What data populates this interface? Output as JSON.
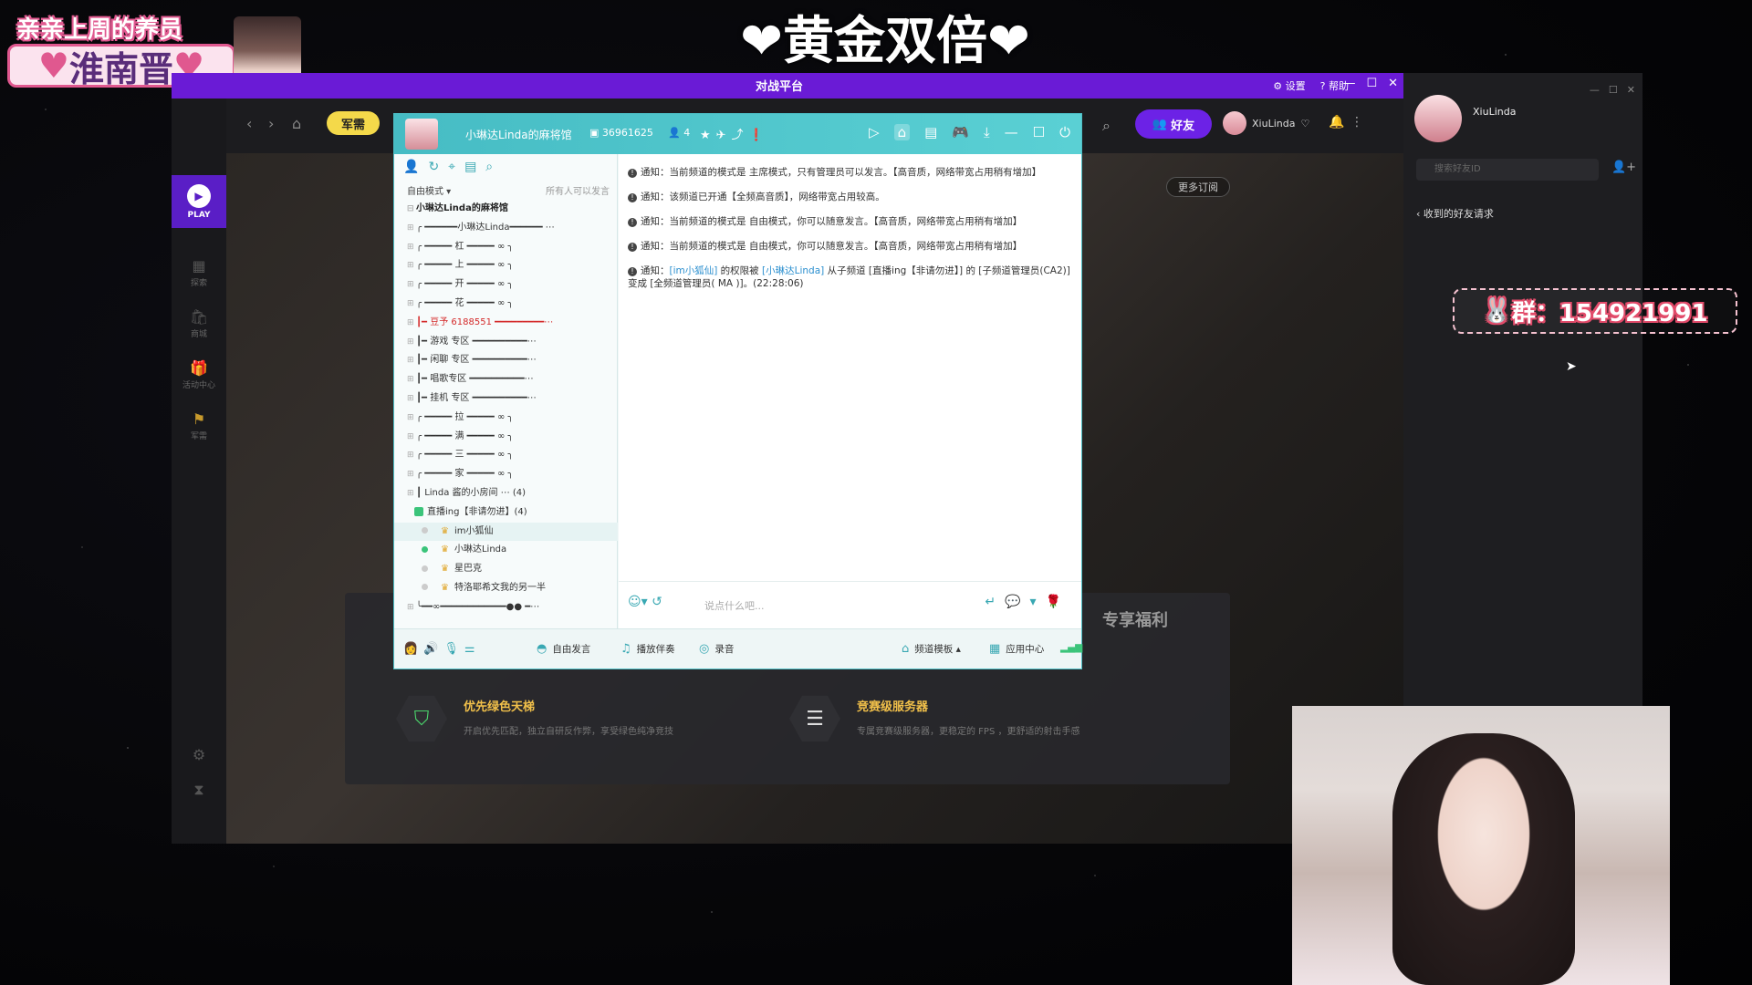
{
  "overlay": {
    "tag_top": "亲亲上周的养员",
    "tag_name": "淮南晋",
    "title": "黄金双倍",
    "group_banner": "群：154921991"
  },
  "app": {
    "logo": "对战平台",
    "settings_label": "设置",
    "help_label": "帮助",
    "junxu_label": "军需",
    "play_label": "PLAY",
    "sidebar": [
      {
        "label": "探索",
        "icon": "explore-icon"
      },
      {
        "label": "商城",
        "icon": "shop-icon"
      },
      {
        "label": "活动中心",
        "icon": "gift-icon"
      },
      {
        "label": "军需",
        "icon": "flag-icon"
      }
    ],
    "friend_button": "好友",
    "username": "XiuLinda",
    "more_subscriptions": "更多订阅",
    "perk_title_right": "专享福利",
    "perks": [
      {
        "title": "优先绿色天梯",
        "desc": "开启优先匹配，独立自研反作弊，享受绿色纯净竞技"
      },
      {
        "title": "竞赛级服务器",
        "desc": "专属竞赛级服务器，更稳定的 FPS ，更舒适的射击手感"
      }
    ]
  },
  "room": {
    "name": "小琳达Linda的麻将馆",
    "id": "36961625",
    "online": "4",
    "mode": "自由模式",
    "mode_right": "所有人可以发言",
    "channels": [
      {
        "text": "小琳达Linda的麻将馆",
        "style": "bold"
      },
      {
        "text": "╭ ━━━━━━小琳达Linda━━━━━━ ⋯",
        "style": ""
      },
      {
        "text": "╭ ━━━━━ 杠 ━━━━━ ∞ ╮",
        "style": ""
      },
      {
        "text": "╭ ━━━━━ 上 ━━━━━ ∞ ╮",
        "style": ""
      },
      {
        "text": "╭ ━━━━━ 开 ━━━━━ ∞ ╮",
        "style": ""
      },
      {
        "text": "╭ ━━━━━ 花 ━━━━━ ∞ ╮",
        "style": ""
      },
      {
        "text": "┃━ 豆予 6188551 ━━━━━━━━━⋯",
        "style": "red"
      },
      {
        "text": "┃━ 游戏 专区 ━━━━━━━━━━⋯",
        "style": ""
      },
      {
        "text": "┃━ 闲聊 专区 ━━━━━━━━━━⋯",
        "style": ""
      },
      {
        "text": "┃━ 唱歌专区 ━━━━━━━━━━⋯",
        "style": ""
      },
      {
        "text": "┃━ 挂机 专区 ━━━━━━━━━━⋯",
        "style": ""
      },
      {
        "text": "╭ ━━━━━ 拉 ━━━━━ ∞ ╮",
        "style": ""
      },
      {
        "text": "╭ ━━━━━ 满 ━━━━━ ∞ ╮",
        "style": ""
      },
      {
        "text": "╭ ━━━━━ 三 ━━━━━ ∞ ╮",
        "style": ""
      },
      {
        "text": "╭ ━━━━━ 家 ━━━━━ ∞ ╮",
        "style": ""
      },
      {
        "text": "┃            Linda 酱的小房间  ⋯ (4)",
        "style": ""
      }
    ],
    "subchannel": "直播ing【非请勿进】(4)",
    "users": [
      {
        "name": "im小狐仙",
        "online": false
      },
      {
        "name": "小琳达Linda",
        "online": true
      },
      {
        "name": "星巴克",
        "online": false
      },
      {
        "name": "特洛耶希文我的另一半",
        "online": false
      }
    ],
    "last_channel": "╰━━∞━━━━━━━━━━━━●● ━⋯",
    "notices": [
      "通知：当前频道的模式是 主席模式，只有管理员可以发言。【高音质，网络带宽占用稍有增加】",
      "通知：该频道已开通【全频高音质】，网络带宽占用较高。",
      "通知：当前频道的模式是 自由模式，你可以随意发言。【高音质，网络带宽占用稍有增加】",
      "通知：当前频道的模式是 自由模式，你可以随意发言。【高音质，网络带宽占用稍有增加】"
    ],
    "notice5": {
      "prefix": "通知：",
      "user1": "[im小狐仙]",
      "mid": " 的权限被 ",
      "user2": "[小琳达Linda]",
      "rest": " 从子频道 [直播ing【非请勿进】] 的 [子频道管理员(CA2)] 变成 [全频道管理员( MA )]。(22:28:06)"
    },
    "input_placeholder": "说点什么吧...",
    "footer": {
      "free_talk": "自由发言",
      "play_accomp": "播放伴奏",
      "record": "录音",
      "template": "频道模板",
      "apps": "应用中心"
    }
  },
  "friends": {
    "username": "XiuLinda",
    "search_placeholder": "搜索好友ID",
    "requests": "收到的好友请求"
  }
}
